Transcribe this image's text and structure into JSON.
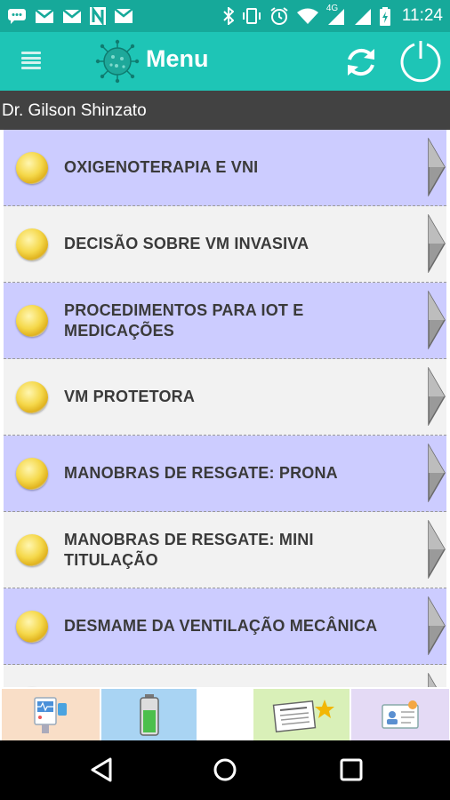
{
  "status_bar": {
    "time": "11:24",
    "network": "4G",
    "icons": [
      "chat-icon",
      "gmail-icon",
      "gmail-icon",
      "n-icon",
      "gallery-icon",
      "bluetooth-icon",
      "vibrate-icon",
      "alarm-icon",
      "wifi-icon",
      "signal-icon",
      "signal-icon",
      "battery-icon"
    ]
  },
  "app_bar": {
    "title": "Menu",
    "icons": [
      "menu-icon",
      "virus-logo-icon",
      "refresh-icon",
      "power-icon"
    ]
  },
  "user": {
    "name": "Dr. Gilson Shinzato"
  },
  "menu_items": [
    {
      "label": "OXIGENOTERAPIA E VNI"
    },
    {
      "label": "DECISÃO SOBRE VM INVASIVA"
    },
    {
      "label": "PROCEDIMENTOS PARA IOT E MEDICAÇÕES"
    },
    {
      "label": "VM PROTETORA"
    },
    {
      "label": "MANOBRAS DE RESGATE: PRONA"
    },
    {
      "label": "MANOBRAS DE RESGATE: MINI TITULAÇÃO"
    },
    {
      "label": "DESMAME DA VENTILAÇÃO MECÂNICA"
    },
    {
      "label": ""
    }
  ],
  "bottom_tabs": [
    {
      "icon": "patient-monitor-icon"
    },
    {
      "icon": "battery-level-icon"
    },
    {
      "icon": ""
    },
    {
      "icon": "news-star-icon"
    },
    {
      "icon": "id-card-icon"
    }
  ],
  "nav_bar": {
    "icons": [
      "back-icon",
      "home-icon",
      "recents-icon"
    ]
  },
  "colors": {
    "status_bar": "#16a99a",
    "app_bar": "#1ec5b6",
    "user_bar": "#424242",
    "item_lavender": "#ccccff",
    "item_white": "#f2f2f2"
  }
}
